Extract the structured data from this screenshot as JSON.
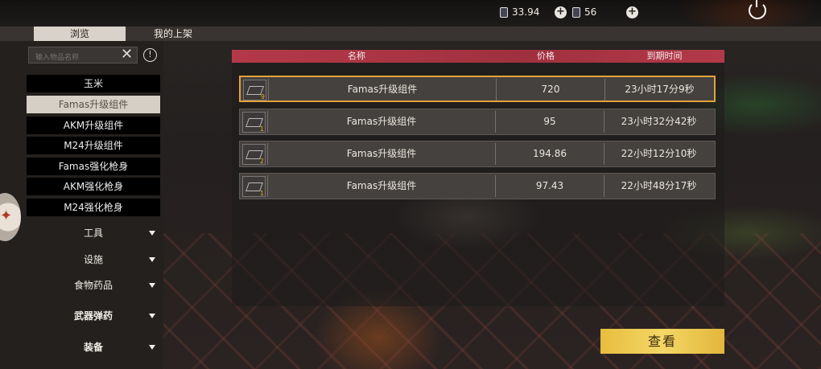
{
  "topbar": {
    "currency1_value": "33.94",
    "currency2_value": "56",
    "icons": [
      "card-icon",
      "plus-icon",
      "phone-icon",
      "plus-icon",
      "power-icon"
    ]
  },
  "tabs": [
    {
      "label": "浏览",
      "active": true
    },
    {
      "label": "我的上架",
      "active": false
    }
  ],
  "sidebar": {
    "search_placeholder": "输入物品名称",
    "items": [
      {
        "label": "玉米",
        "selected": false
      },
      {
        "label": "Famas升级组件",
        "selected": true
      },
      {
        "label": "AKM升级组件",
        "selected": false
      },
      {
        "label": "M24升级组件",
        "selected": false
      },
      {
        "label": "Famas强化枪身",
        "selected": false
      },
      {
        "label": "AKM强化枪身",
        "selected": false
      },
      {
        "label": "M24强化枪身",
        "selected": false
      }
    ],
    "categories": [
      {
        "label": "工具"
      },
      {
        "label": "设施"
      },
      {
        "label": "食物药品"
      },
      {
        "label": "武器弹药"
      },
      {
        "label": "装备"
      }
    ]
  },
  "table": {
    "headers": {
      "name": "名称",
      "price": "价格",
      "expire": "到期时间"
    },
    "rows": [
      {
        "qty": "9",
        "name": "Famas升级组件",
        "price": "720",
        "expire": "23小时17分9秒",
        "selected": true
      },
      {
        "qty": "1",
        "name": "Famas升级组件",
        "price": "95",
        "expire": "23小时32分42秒",
        "selected": false
      },
      {
        "qty": "2",
        "name": "Famas升级组件",
        "price": "194.86",
        "expire": "22小时12分10秒",
        "selected": false
      },
      {
        "qty": "1",
        "name": "Famas升级组件",
        "price": "97.43",
        "expire": "22小时48分17秒",
        "selected": false
      }
    ]
  },
  "actions": {
    "view_label": "查看"
  },
  "colors": {
    "accent": "#e4a23a",
    "header": "#b3394a",
    "button": "#f0cf5a"
  }
}
